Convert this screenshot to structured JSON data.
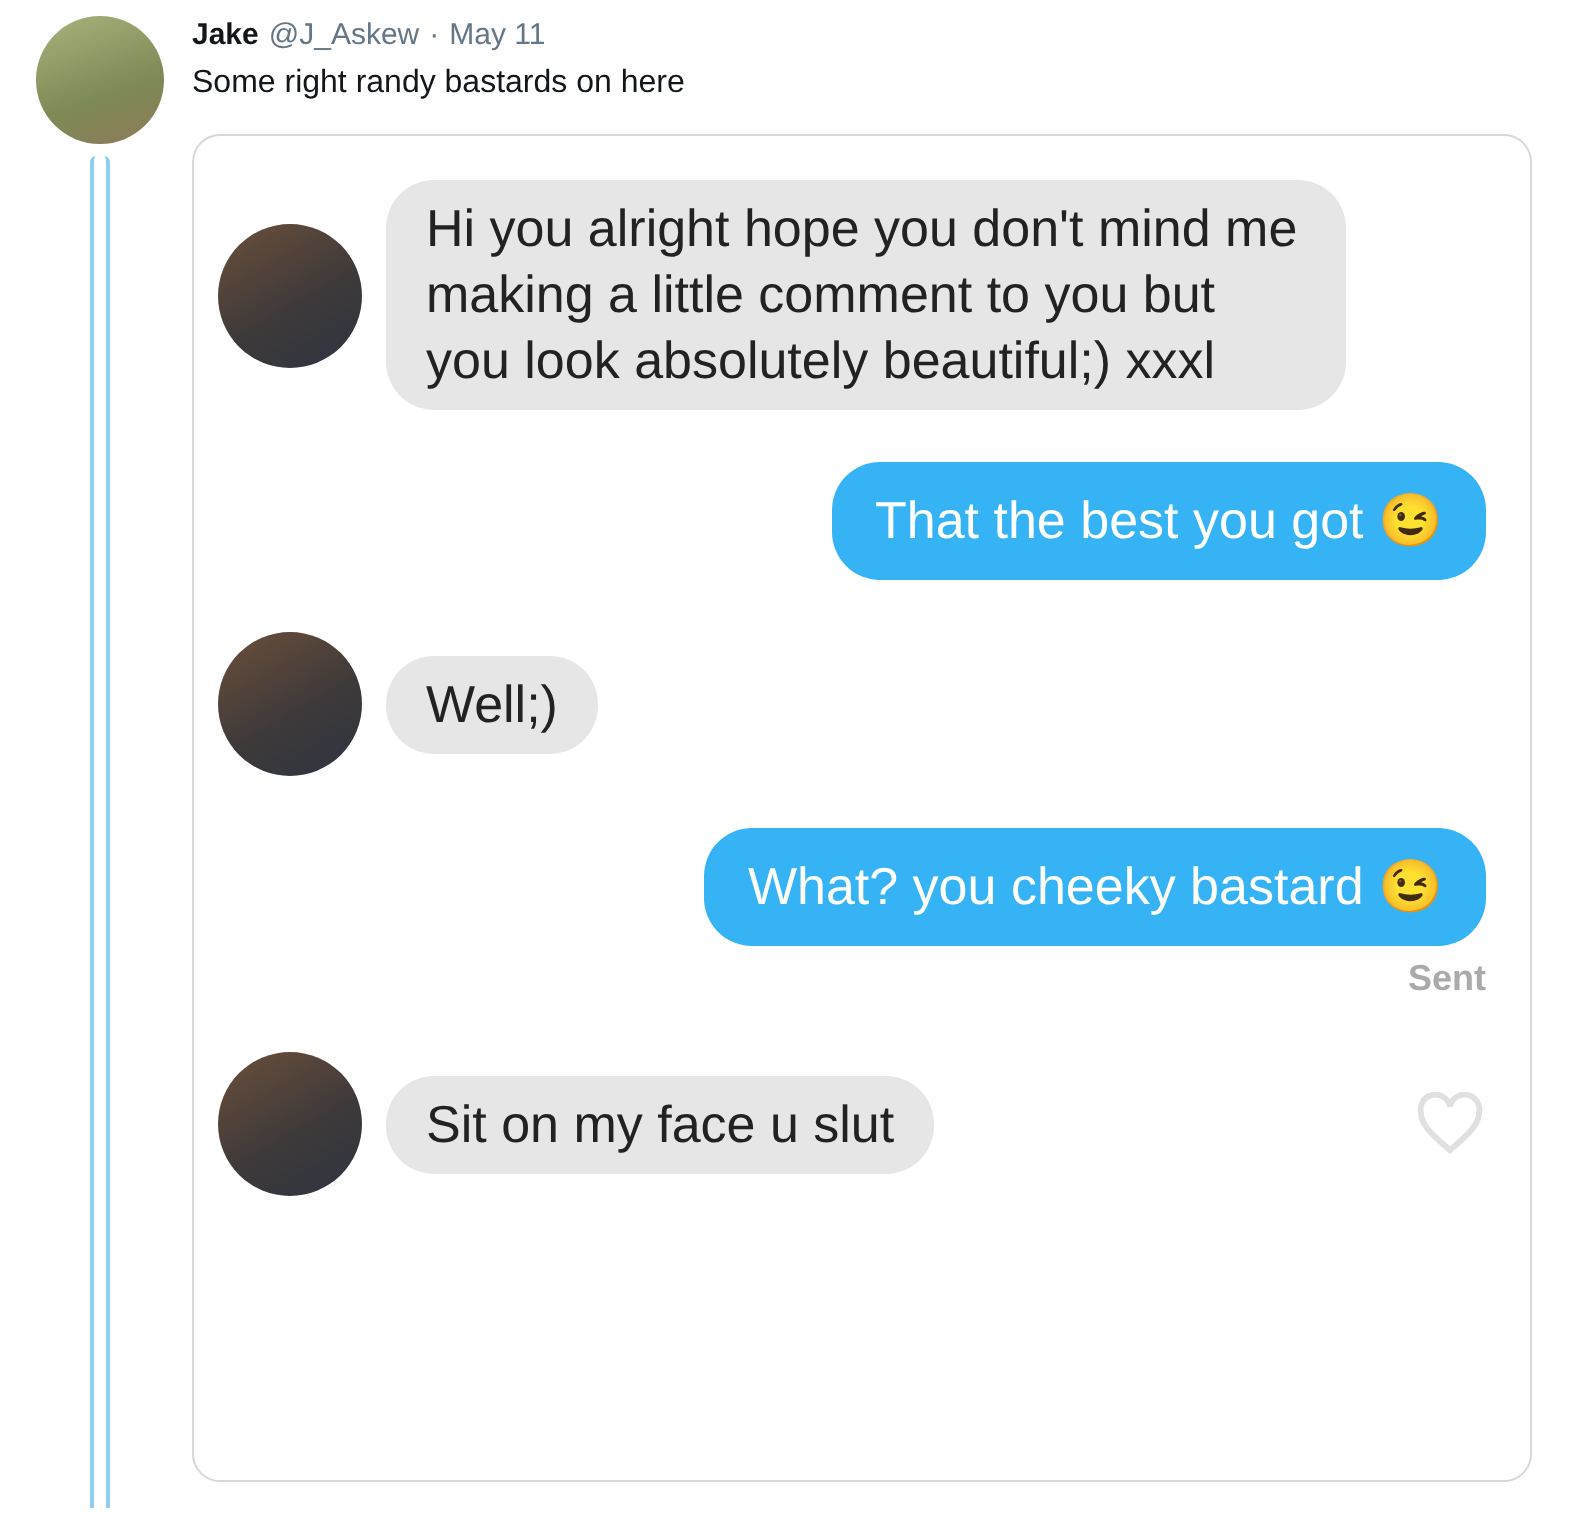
{
  "tweet": {
    "name": "Jake",
    "handle": "@J_Askew",
    "separator": "·",
    "date": "May 11",
    "text": "Some right randy bastards on here"
  },
  "chat": {
    "messages": [
      {
        "kind": "received",
        "text": "Hi you alright hope you don't mind me making a little comment to you but you look absolutely beautiful;) xxxl"
      },
      {
        "kind": "sent",
        "text": "That the best you got 😉"
      },
      {
        "kind": "received",
        "text": "Well;)"
      },
      {
        "kind": "sent",
        "text": "What? you cheeky bastard 😉",
        "status": "Sent"
      },
      {
        "kind": "received",
        "text": "Sit on my face u slut",
        "liked": false
      }
    ]
  }
}
